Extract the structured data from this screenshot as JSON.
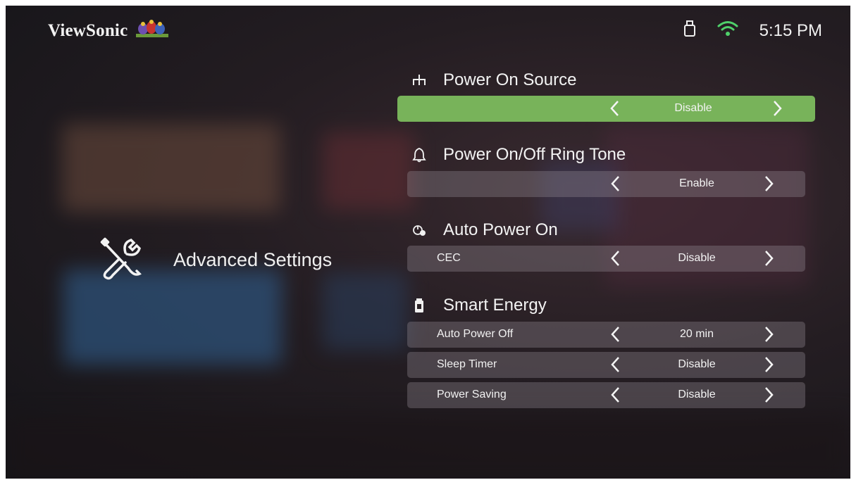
{
  "brand": {
    "name": "ViewSonic",
    "logo_icon": "birds-logo-icon"
  },
  "status": {
    "time": "5:15 PM",
    "usb_icon": "usb-icon",
    "wifi_icon": "wifi-icon",
    "wifi_color": "#4fd16a"
  },
  "section": {
    "title": "Advanced Settings",
    "icon": "tools-icon"
  },
  "groups": [
    {
      "title": "Power On Source",
      "icon": "source-icon"
    },
    {
      "title": "Power On/Off Ring Tone",
      "icon": "bell-icon"
    },
    {
      "title": "Auto Power On",
      "icon": "power-clock-icon"
    },
    {
      "title": "Smart Energy",
      "icon": "battery-icon"
    }
  ],
  "rows": [
    {
      "label": "",
      "value": "Disable",
      "selected": true
    },
    {
      "label": "",
      "value": "Enable"
    },
    {
      "label": "CEC",
      "value": "Disable"
    },
    {
      "label": "Auto Power Off",
      "value": "20 min"
    },
    {
      "label": "Sleep Timer",
      "value": "Disable"
    },
    {
      "label": "Power Saving",
      "value": "Disable"
    }
  ],
  "colors": {
    "accent": "#78b35a",
    "text": "#f0f0f0"
  }
}
